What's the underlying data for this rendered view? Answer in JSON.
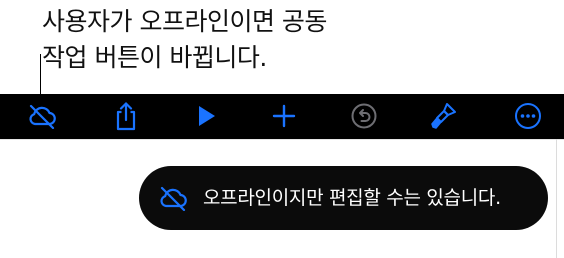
{
  "callout": {
    "line1": "사용자가 오프라인이면 공동",
    "line2": "작업 버튼이 바뀝니다."
  },
  "toolbar": {
    "buttons": [
      {
        "icon": "cloud-offline-icon",
        "enabled": true
      },
      {
        "icon": "share-icon",
        "enabled": true
      },
      {
        "icon": "play-icon",
        "enabled": true
      },
      {
        "icon": "add-icon",
        "enabled": true
      },
      {
        "icon": "undo-icon",
        "enabled": false
      },
      {
        "icon": "format-brush-icon",
        "enabled": true
      },
      {
        "icon": "more-icon",
        "enabled": true
      }
    ],
    "accent_color": "#1a73ff",
    "disabled_color": "#6e6e73"
  },
  "toast": {
    "message": "오프라인이지만 편집할 수는 있습니다.",
    "icon": "cloud-offline-icon"
  }
}
